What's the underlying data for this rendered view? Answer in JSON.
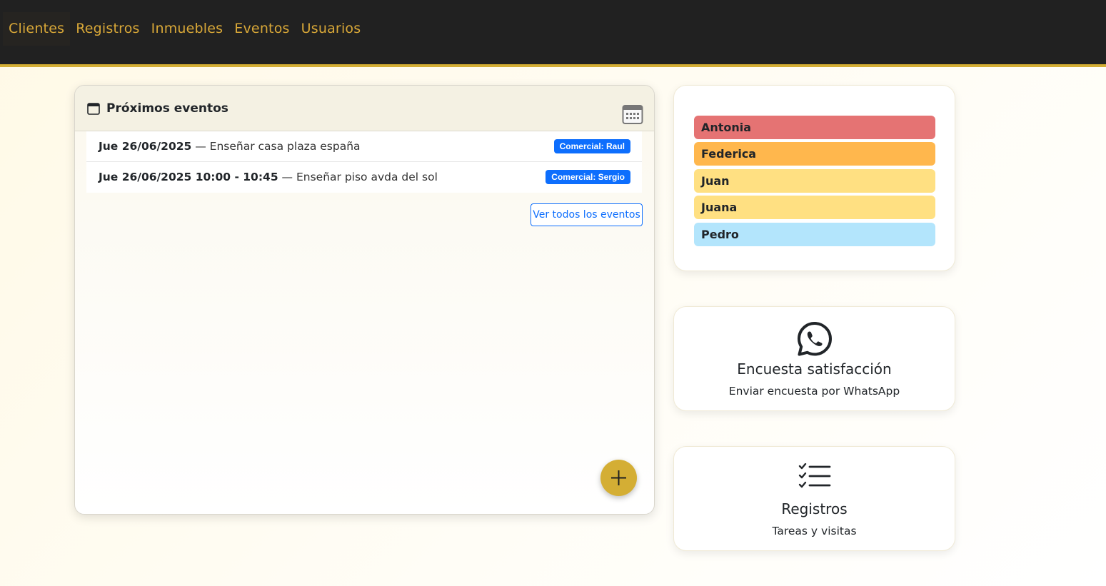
{
  "nav": {
    "items": [
      {
        "label": "Clientes",
        "active": true
      },
      {
        "label": "Registros"
      },
      {
        "label": "Inmuebles"
      },
      {
        "label": "Eventos"
      },
      {
        "label": "Usuarios"
      }
    ]
  },
  "events": {
    "title": "Próximos eventos",
    "items": [
      {
        "date": "Jue 26/06/2025",
        "separator": " — ",
        "description": "Enseñar casa plaza españa",
        "badge": "Comercial: Raul"
      },
      {
        "date": "Jue 26/06/2025 10:00 - 10:45",
        "separator": " — ",
        "description": "Enseñar piso avda del sol",
        "badge": "Comercial: Sergio"
      }
    ],
    "view_all_label": "Ver todos los eventos"
  },
  "users": {
    "items": [
      {
        "name": "Antonia",
        "color": "#e57373"
      },
      {
        "name": "Federica",
        "color": "#ffb74d"
      },
      {
        "name": "Juan",
        "color": "#ffe082"
      },
      {
        "name": "Juana",
        "color": "#ffe082"
      },
      {
        "name": "Pedro",
        "color": "#b3e5fc"
      }
    ]
  },
  "whatsapp_card": {
    "icon": "whatsapp-icon",
    "title": "Encuesta satisfacción",
    "subtitle": "Enviar encuesta por WhatsApp"
  },
  "registros_card": {
    "icon": "checklist-icon",
    "title": "Registros",
    "subtitle": "Tareas y visitas"
  },
  "colors": {
    "navbar_bg": "#212121",
    "accent": "#d4ae34",
    "nav_text": "#d9a838",
    "badge": "#0d6efd"
  }
}
